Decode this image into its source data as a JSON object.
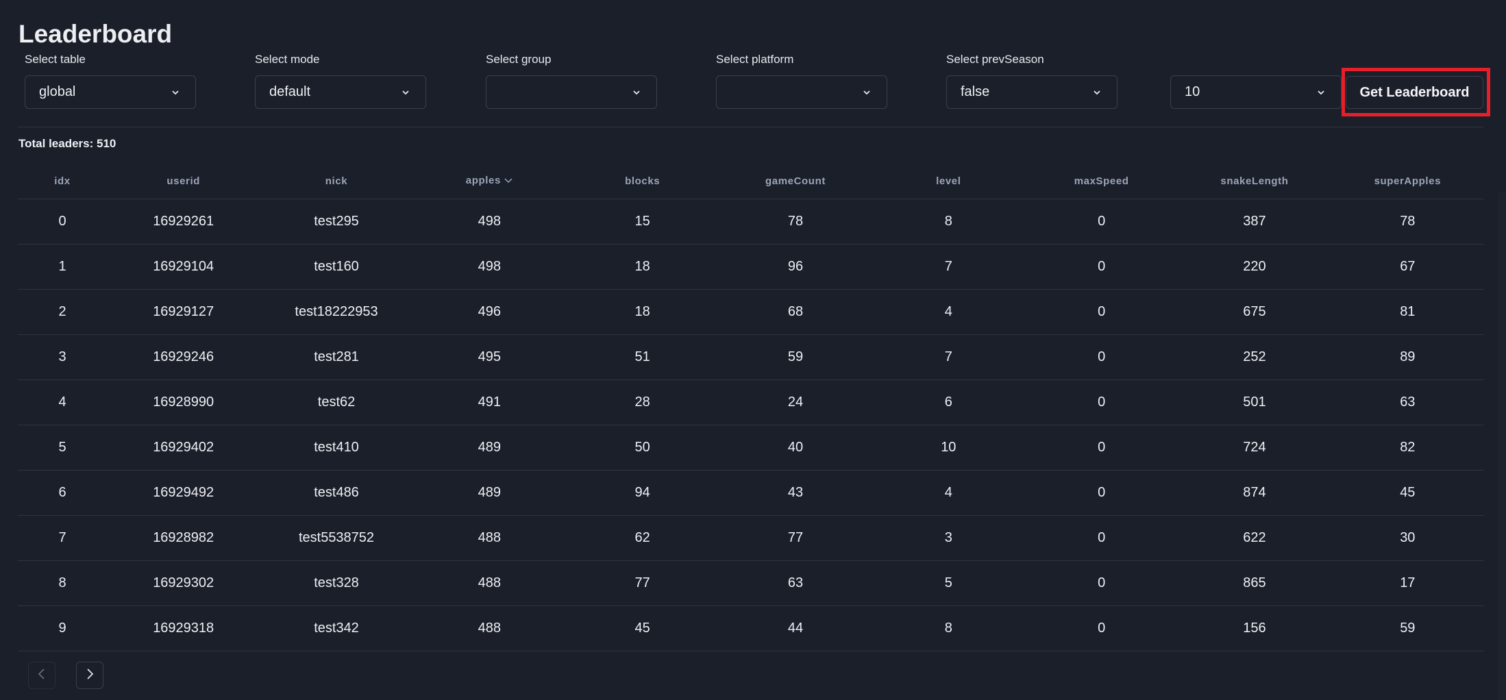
{
  "page": {
    "title": "Leaderboard"
  },
  "filters": {
    "table": {
      "label": "Select table",
      "value": "global"
    },
    "mode": {
      "label": "Select mode",
      "value": "default"
    },
    "group": {
      "label": "Select group",
      "value": ""
    },
    "platform": {
      "label": "Select platform",
      "value": ""
    },
    "prevSeason": {
      "label": "Select prevSeason",
      "value": "false"
    },
    "pageSize": {
      "label": "",
      "value": "10"
    }
  },
  "actions": {
    "get_leaderboard": "Get Leaderboard"
  },
  "summary": {
    "total_label": "Total leaders: 510"
  },
  "table": {
    "sorted_by": "apples",
    "sort_direction": "desc",
    "columns": [
      "idx",
      "userid",
      "nick",
      "apples",
      "blocks",
      "gameCount",
      "level",
      "maxSpeed",
      "snakeLength",
      "superApples"
    ],
    "rows": [
      [
        "0",
        "16929261",
        "test295",
        "498",
        "15",
        "78",
        "8",
        "0",
        "387",
        "78"
      ],
      [
        "1",
        "16929104",
        "test160",
        "498",
        "18",
        "96",
        "7",
        "0",
        "220",
        "67"
      ],
      [
        "2",
        "16929127",
        "test18222953",
        "496",
        "18",
        "68",
        "4",
        "0",
        "675",
        "81"
      ],
      [
        "3",
        "16929246",
        "test281",
        "495",
        "51",
        "59",
        "7",
        "0",
        "252",
        "89"
      ],
      [
        "4",
        "16928990",
        "test62",
        "491",
        "28",
        "24",
        "6",
        "0",
        "501",
        "63"
      ],
      [
        "5",
        "16929402",
        "test410",
        "489",
        "50",
        "40",
        "10",
        "0",
        "724",
        "82"
      ],
      [
        "6",
        "16929492",
        "test486",
        "489",
        "94",
        "43",
        "4",
        "0",
        "874",
        "45"
      ],
      [
        "7",
        "16928982",
        "test5538752",
        "488",
        "62",
        "77",
        "3",
        "0",
        "622",
        "30"
      ],
      [
        "8",
        "16929302",
        "test328",
        "488",
        "77",
        "63",
        "5",
        "0",
        "865",
        "17"
      ],
      [
        "9",
        "16929318",
        "test342",
        "488",
        "45",
        "44",
        "8",
        "0",
        "156",
        "59"
      ]
    ]
  },
  "pagination": {
    "prev": {
      "icon": "chevron-left-icon",
      "disabled": true
    },
    "next": {
      "icon": "chevron-right-icon",
      "disabled": false
    }
  },
  "colors": {
    "background": "#1b1f2a",
    "border": "#3a3f4b",
    "header_text": "#9aa5b8",
    "highlight": "#e5202a"
  }
}
